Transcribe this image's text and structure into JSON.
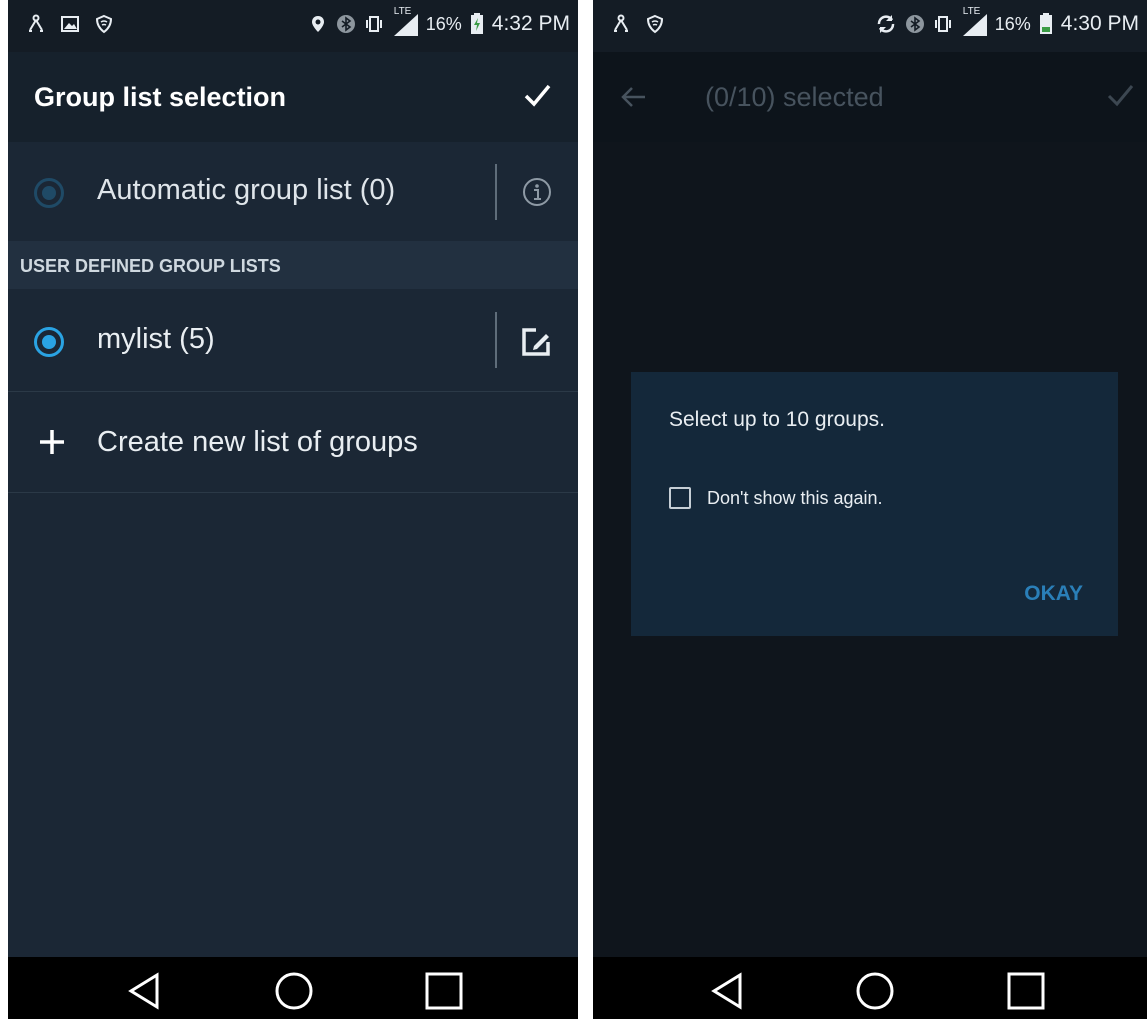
{
  "colors": {
    "accent": "#2aa3e3",
    "dialog_button": "#2a7fb8",
    "background": "#1b2735"
  },
  "left_screen": {
    "status_bar": {
      "left_icons": [
        "tree-network-icon",
        "image-icon",
        "wifi-shield-icon"
      ],
      "right_icons": [
        "location-icon",
        "bluetooth-icon",
        "vibrate-icon",
        "lte-signal-icon",
        "battery-charging-icon"
      ],
      "network_label": "LTE",
      "battery": "16%",
      "time": "4:32 PM"
    },
    "app_bar": {
      "title": "Group list selection",
      "confirm_icon": "check-icon"
    },
    "automatic_row": {
      "label": "Automatic group list (0)",
      "icon": "info-icon",
      "selected": false
    },
    "section_header": "USER DEFINED GROUP LISTS",
    "user_list_row": {
      "label": "mylist (5)",
      "icon": "edit-icon",
      "selected": true
    },
    "create_row": {
      "label": "Create new list of groups",
      "icon": "plus-icon"
    },
    "nav_bar": [
      "back-icon",
      "home-icon",
      "recents-icon"
    ]
  },
  "right_screen": {
    "status_bar": {
      "left_icons": [
        "tree-network-icon",
        "wifi-shield-icon"
      ],
      "right_icons": [
        "sync-icon",
        "bluetooth-icon",
        "vibrate-icon",
        "lte-signal-icon",
        "battery-icon"
      ],
      "network_label": "LTE",
      "battery": "16%",
      "time": "4:30 PM"
    },
    "app_bar": {
      "title": "(0/10) selected",
      "back_icon": "arrow-back-icon",
      "confirm_icon": "check-icon"
    },
    "dialog": {
      "message": "Select up to 10 groups.",
      "checkbox_label": "Don't show this again.",
      "checkbox_checked": false,
      "button_label": "OKAY"
    },
    "nav_bar": [
      "back-icon",
      "home-icon",
      "recents-icon"
    ]
  }
}
